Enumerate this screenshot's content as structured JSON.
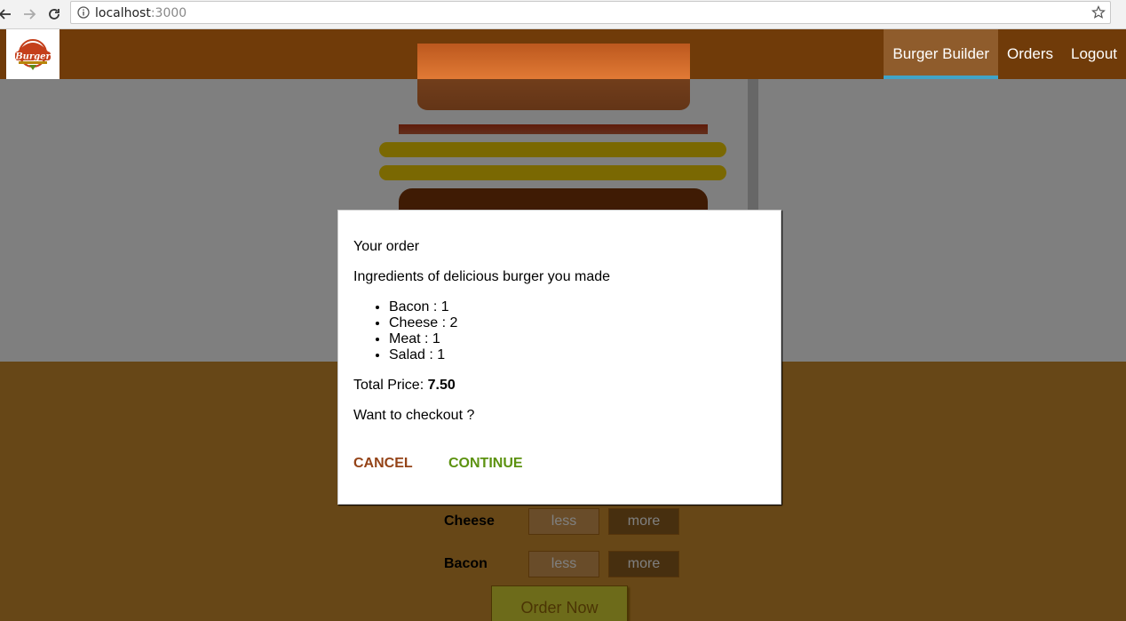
{
  "browser": {
    "url_host": "localhost",
    "url_port": ":3000"
  },
  "nav": {
    "items": [
      {
        "label": "Burger Builder",
        "active": true
      },
      {
        "label": "Orders",
        "active": false
      },
      {
        "label": "Logout",
        "active": false
      }
    ]
  },
  "logo": {
    "text": "Burger"
  },
  "controls": [
    {
      "label": "Cheese",
      "less": "less",
      "more": "more"
    },
    {
      "label": "Bacon",
      "less": "less",
      "more": "more"
    }
  ],
  "order_button": "Order Now",
  "modal": {
    "title": "Your order",
    "subtitle": "Ingredients of delicious burger you made",
    "ingredients": [
      "Bacon : 1",
      "Cheese : 2",
      "Meat : 1",
      "Salad : 1"
    ],
    "price_label": "Total Price: ",
    "price_value": "7.50",
    "question": "Want to checkout ?",
    "cancel": "CANCEL",
    "continue": "CONTINUE"
  },
  "colors": {
    "toolbar": "#703b09",
    "active_underline": "#40a4c8",
    "controls_bg": "#cf8f2e",
    "cancel": "#944317",
    "continue": "#5c9210"
  }
}
